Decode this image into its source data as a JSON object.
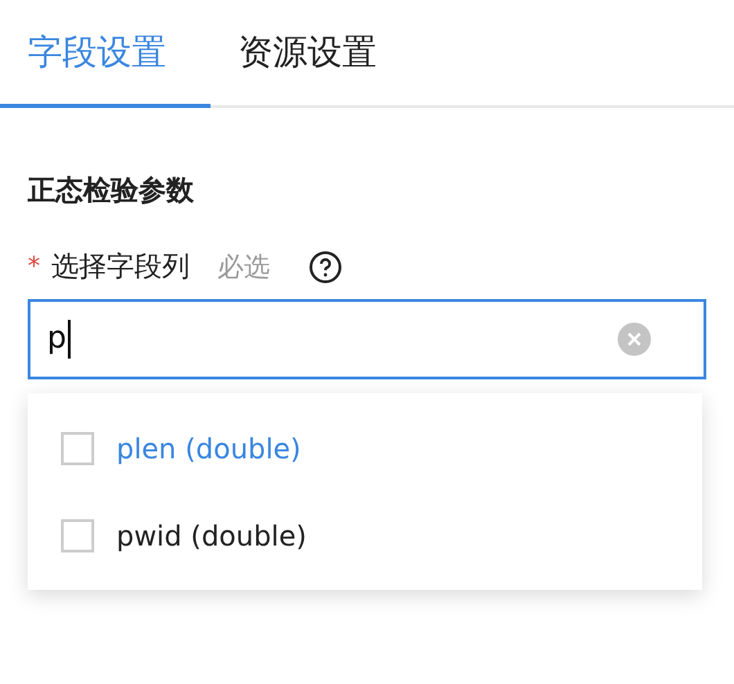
{
  "tabs": [
    {
      "label": "字段设置",
      "selected": true
    },
    {
      "label": "资源设置",
      "selected": false
    }
  ],
  "section_title": "正态检验参数",
  "field": {
    "required": true,
    "required_mark": "*",
    "label": "选择字段列",
    "hint": "必选",
    "value": "p",
    "focused": true
  },
  "dropdown": {
    "options": [
      {
        "label": "plen (double)",
        "active": true,
        "checked": false
      },
      {
        "label": "pwid (double)",
        "active": false,
        "checked": false
      }
    ]
  }
}
